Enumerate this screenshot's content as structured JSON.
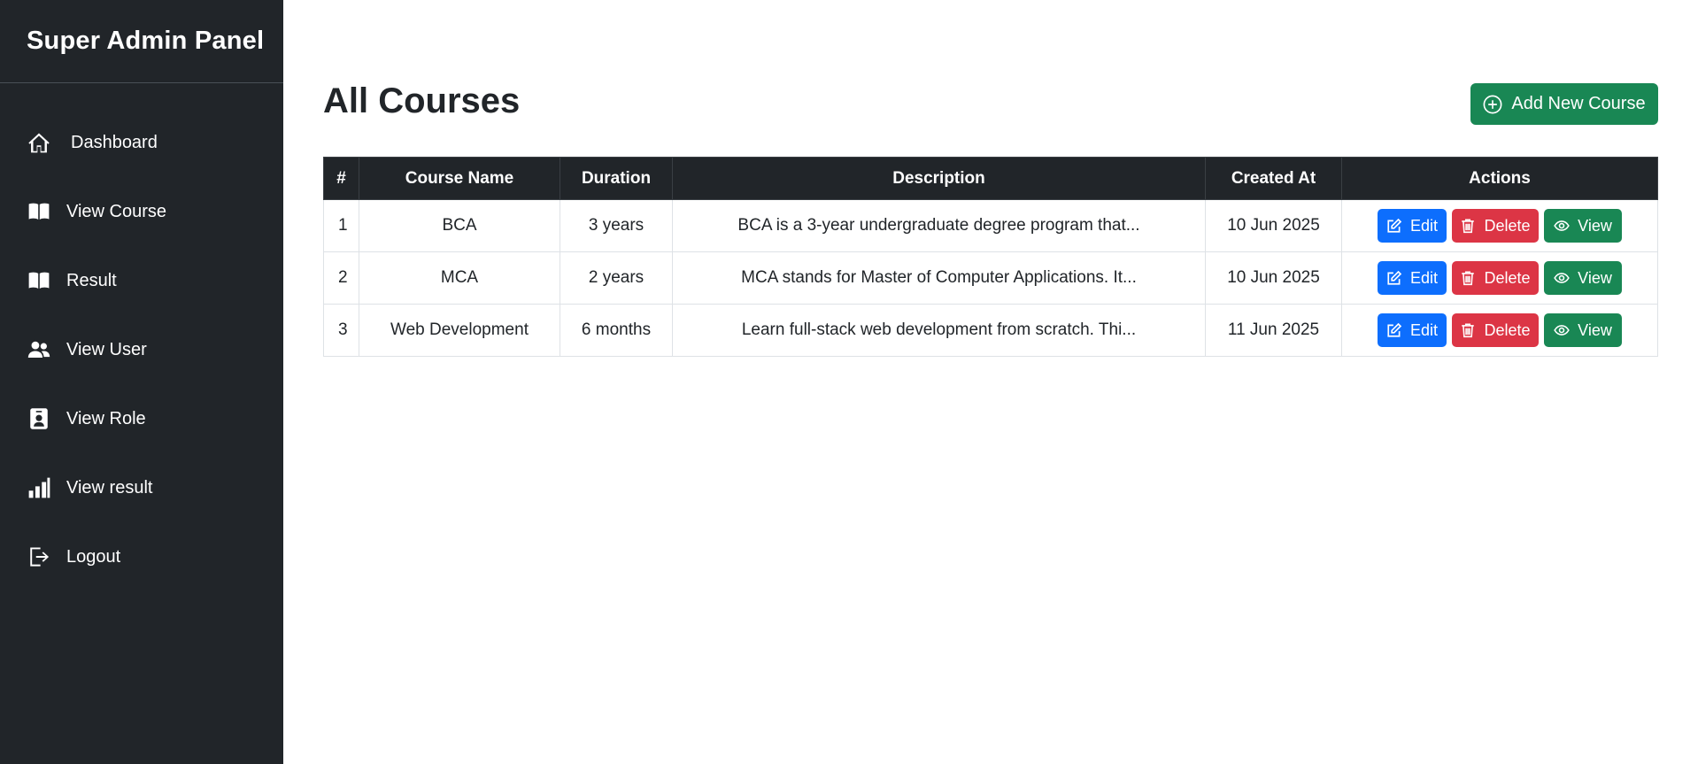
{
  "sidebar": {
    "title": "Super Admin Panel",
    "items": [
      {
        "label": "Dashboard",
        "icon": "house-icon"
      },
      {
        "label": "View Course",
        "icon": "book-icon"
      },
      {
        "label": "Result",
        "icon": "book-icon"
      },
      {
        "label": "View User",
        "icon": "people-icon"
      },
      {
        "label": "View Role",
        "icon": "person-badge-icon"
      },
      {
        "label": "View result",
        "icon": "bar-chart-icon"
      },
      {
        "label": "Logout",
        "icon": "logout-icon"
      }
    ]
  },
  "main": {
    "title": "All Courses",
    "add_button": "Add New Course",
    "table": {
      "columns": [
        "#",
        "Course Name",
        "Duration",
        "Description",
        "Created At",
        "Actions"
      ],
      "rows": [
        {
          "num": "1",
          "name": "BCA",
          "duration": "3 years",
          "description": "BCA is a 3-year undergraduate degree program that...",
          "created": "10 Jun 2025"
        },
        {
          "num": "2",
          "name": "MCA",
          "duration": "2 years",
          "description": "MCA stands for Master of Computer Applications. It...",
          "created": "10 Jun 2025"
        },
        {
          "num": "3",
          "name": "Web Development",
          "duration": "6 months",
          "description": "Learn full-stack web development from scratch. Thi...",
          "created": "11 Jun 2025"
        }
      ],
      "actions": {
        "edit": "Edit",
        "delete": "Delete",
        "view": "View"
      }
    }
  },
  "colors": {
    "sidebar_bg": "#212529",
    "primary": "#0d6efd",
    "danger": "#dc3545",
    "success": "#198754"
  }
}
